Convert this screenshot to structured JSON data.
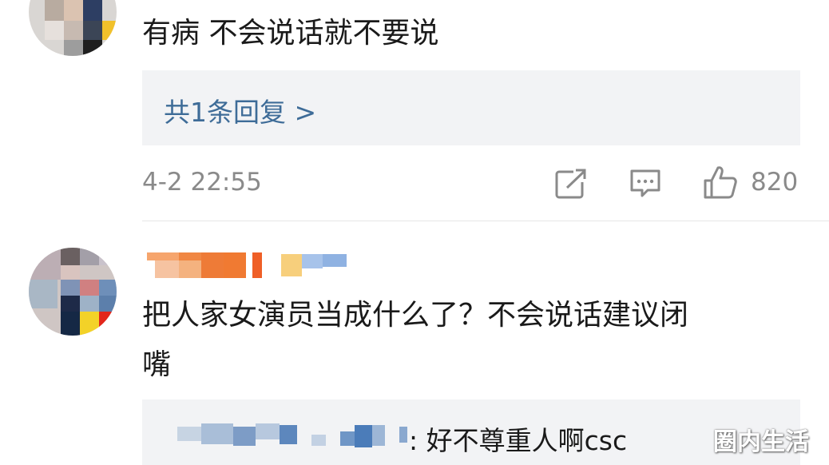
{
  "comment1": {
    "text": "有病 不会说话就不要说",
    "replies_link": "共1条回复 >",
    "timestamp": "4-2 22:55",
    "like_count": "820"
  },
  "comment2": {
    "text_line1": "把人家女演员当成什么了？不会说话建议闭",
    "text_line2": "嘴",
    "reply_preview": ": 好不尊重人啊csc"
  },
  "watermark": "圈内生活",
  "icons": {
    "share": "share-icon",
    "comment": "comment-icon",
    "like": "thumbs-up-icon"
  }
}
